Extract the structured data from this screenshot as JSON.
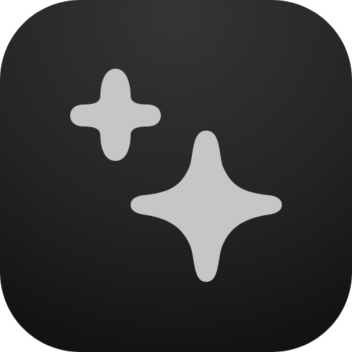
{
  "app_icon": {
    "name": "sparkles-app-icon",
    "glyph_icon": "sparkles-icon",
    "colors": {
      "background_top": "#353535",
      "background_bottom": "#111111",
      "glyph": "#c6c6c6"
    }
  }
}
